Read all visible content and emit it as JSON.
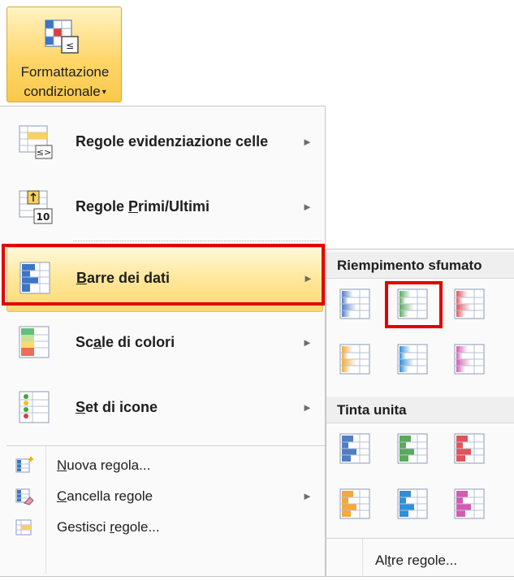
{
  "ribbon": {
    "label_line1": "Formattazione",
    "label_line2": "condizionale",
    "caret": "▾",
    "icon": "conditional-formatting-icon"
  },
  "menu": {
    "items": [
      {
        "pre": "Regole evidenziazione celle",
        "u": "",
        "post": "",
        "arrow": "►",
        "icon": "highlight-cells-rules-icon"
      },
      {
        "pre": "Regole ",
        "u": "P",
        "post": "rimi/Ultimi",
        "arrow": "►",
        "icon": "top-bottom-rules-icon"
      },
      {
        "pre": "",
        "u": "B",
        "post": "arre dei dati",
        "arrow": "►",
        "icon": "data-bars-icon"
      },
      {
        "pre": "Sc",
        "u": "a",
        "post": "le di colori",
        "arrow": "►",
        "icon": "color-scales-icon"
      },
      {
        "pre": "",
        "u": "S",
        "post": "et di icone",
        "arrow": "►",
        "icon": "icon-sets-icon"
      }
    ],
    "small_items": [
      {
        "pre": "",
        "u": "N",
        "post": "uova regola...",
        "arrow": "",
        "icon": "new-rule-icon"
      },
      {
        "pre": "",
        "u": "C",
        "post": "ancella regole",
        "arrow": "►",
        "icon": "clear-rules-icon"
      },
      {
        "pre": "Gestisci ",
        "u": "r",
        "post": "egole...",
        "arrow": "",
        "icon": "manage-rules-icon"
      }
    ]
  },
  "submenu": {
    "gradient_header": "Riempimento sfumato",
    "solid_header": "Tinta unita",
    "more": {
      "pre": "Al",
      "u": "t",
      "post": "re regole..."
    },
    "colors": {
      "blue": "#4f7ec2",
      "green": "#5aaa5a",
      "red": "#e0545a",
      "orange": "#f4a93a",
      "light_blue": "#2f8fd8",
      "purple": "#d45bb0"
    }
  },
  "accent": {
    "highlight": "#ffe79a",
    "callout": "#e30000"
  }
}
